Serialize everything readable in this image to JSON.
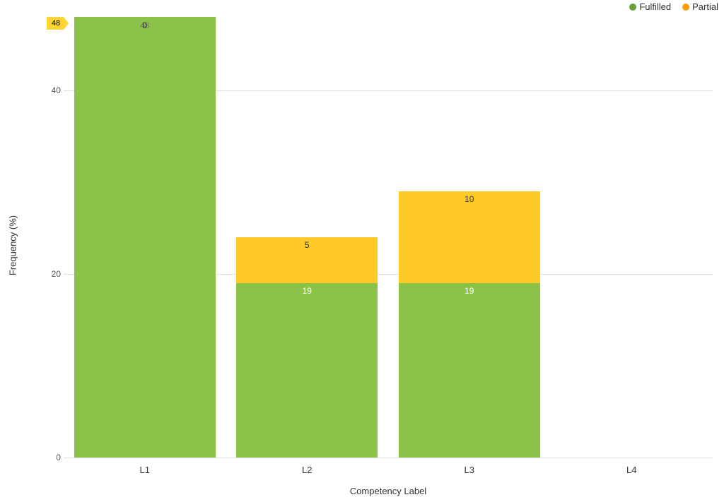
{
  "chart_data": {
    "type": "bar",
    "stacked": true,
    "categories": [
      "L1",
      "L2",
      "L3",
      "L4"
    ],
    "series": [
      {
        "name": "Fulfilled",
        "color": "#8bc34a",
        "darker": "#689f38",
        "values": [
          48,
          19,
          19,
          0
        ]
      },
      {
        "name": "Partial",
        "color": "#ffca28",
        "darker": "#ffa000",
        "values": [
          0,
          5,
          10,
          0
        ]
      }
    ],
    "l1_overlap_labels": [
      "48",
      "0"
    ],
    "xlabel": "Competency Label",
    "ylabel": "Frequency (%)",
    "y_ticks": [
      0,
      20,
      40
    ],
    "ylim": [
      0,
      48
    ],
    "marker_value": 48
  }
}
